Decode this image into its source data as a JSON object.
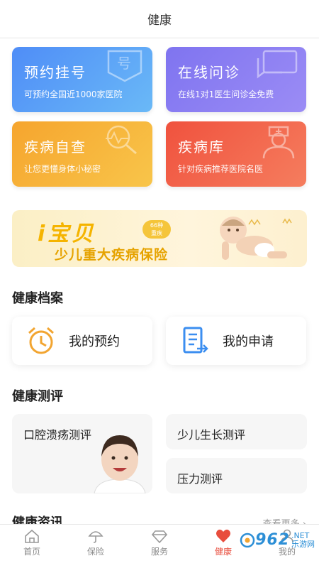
{
  "header": {
    "title": "健康"
  },
  "services": [
    {
      "title": "预约挂号",
      "subtitle": "可预约全国近1000家医院",
      "icon": "ticket-icon",
      "color": "#4f8df7"
    },
    {
      "title": "在线问诊",
      "subtitle": "在线1对1医生问诊全免费",
      "icon": "chat-icon",
      "color": "#8a7ef2"
    },
    {
      "title": "疾病自查",
      "subtitle": "让您更懂身体小秘密",
      "icon": "magnifier-pulse-icon",
      "color": "#f6a52e"
    },
    {
      "title": "疾病库",
      "subtitle": "针对疾病推荐医院名医",
      "icon": "doctor-icon",
      "color": "#f0523e"
    }
  ],
  "banner": {
    "brand": "i宝贝",
    "badge_line1": "66种",
    "badge_line2": "重疾",
    "subtitle": "少儿重大疾病保险"
  },
  "records": {
    "title": "健康档案",
    "items": [
      {
        "label": "我的预约",
        "icon": "alarm-clock-icon"
      },
      {
        "label": "我的申请",
        "icon": "document-arrow-icon"
      }
    ]
  },
  "evaluation": {
    "title": "健康测评",
    "items": [
      {
        "label": "口腔溃疡测评"
      },
      {
        "label": "少儿生长测评"
      },
      {
        "label": "压力测评"
      }
    ]
  },
  "news": {
    "title": "健康资讯",
    "more": "查看更多"
  },
  "tabbar": {
    "items": [
      {
        "label": "首页",
        "icon": "home-icon"
      },
      {
        "label": "保险",
        "icon": "umbrella-icon"
      },
      {
        "label": "服务",
        "icon": "diamond-icon"
      },
      {
        "label": "健康",
        "icon": "heart-icon",
        "active": true
      },
      {
        "label": "我的",
        "icon": "person-icon"
      }
    ],
    "active_color": "#e84d3d"
  },
  "watermark": {
    "text": "962",
    "suffix": ".NET",
    "sub": "乐游网"
  }
}
